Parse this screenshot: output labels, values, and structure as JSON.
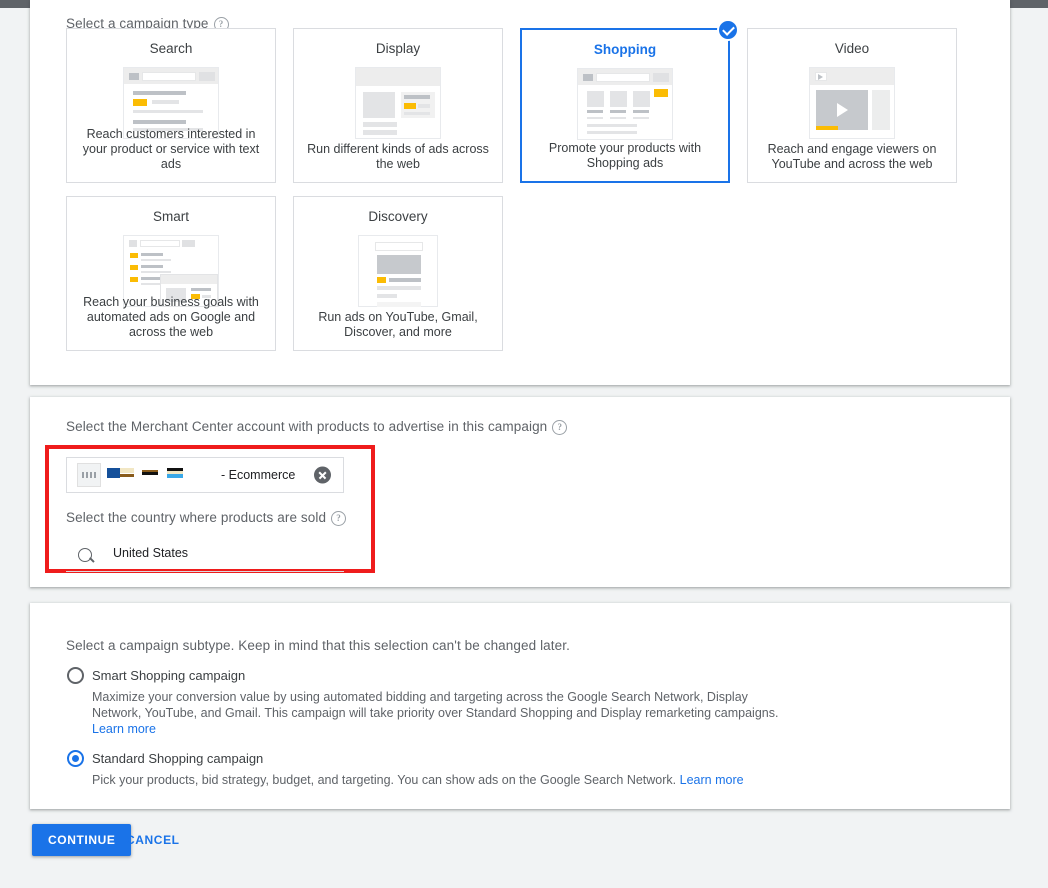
{
  "campaign_type": {
    "label": "Select a campaign type",
    "help_icon": "help-circle-icon",
    "cards": [
      {
        "title": "Search",
        "desc": "Reach customers interested in your product or service with text ads",
        "selected": false
      },
      {
        "title": "Display",
        "desc": "Run different kinds of ads across the web",
        "selected": false
      },
      {
        "title": "Shopping",
        "desc": "Promote your products with Shopping ads",
        "selected": true
      },
      {
        "title": "Video",
        "desc": "Reach and engage viewers on YouTube and across the web",
        "selected": false
      },
      {
        "title": "Smart",
        "desc": "Reach your business goals with automated ads on Google and across the web",
        "selected": false
      },
      {
        "title": "Discovery",
        "desc": "Run ads on YouTube, Gmail, Discover, and more",
        "selected": false
      }
    ]
  },
  "merchant": {
    "label": "Select the Merchant Center account with products to advertise in this campaign",
    "help_icon": "help-circle-icon",
    "account_name": "- Ecommerce",
    "account_redacted": true,
    "clear_icon": "clear-circle-icon",
    "country_label": "Select the country where products are sold",
    "country_help_icon": "help-circle-icon",
    "country_value": "United States",
    "search_icon": "search-icon",
    "highlight_color": "#ef1c1c"
  },
  "subtype": {
    "label": "Select a campaign subtype. Keep in mind that this selection can't be changed later.",
    "options": [
      {
        "title": "Smart Shopping campaign",
        "desc": "Maximize your conversion value by using automated bidding and targeting across the Google Search Network, Display Network, YouTube, and Gmail. This campaign will take priority over Standard Shopping and Display remarketing campaigns.",
        "link": "Learn more",
        "link_inline": false,
        "selected": false
      },
      {
        "title": "Standard Shopping campaign",
        "desc": "Pick your products, bid strategy, budget, and targeting. You can show ads on the Google Search Network.",
        "link": "Learn more",
        "link_inline": true,
        "selected": true
      }
    ]
  },
  "actions": {
    "continue_label": "CONTINUE",
    "cancel_label": "CANCEL",
    "accent_color": "#1a73e8"
  }
}
